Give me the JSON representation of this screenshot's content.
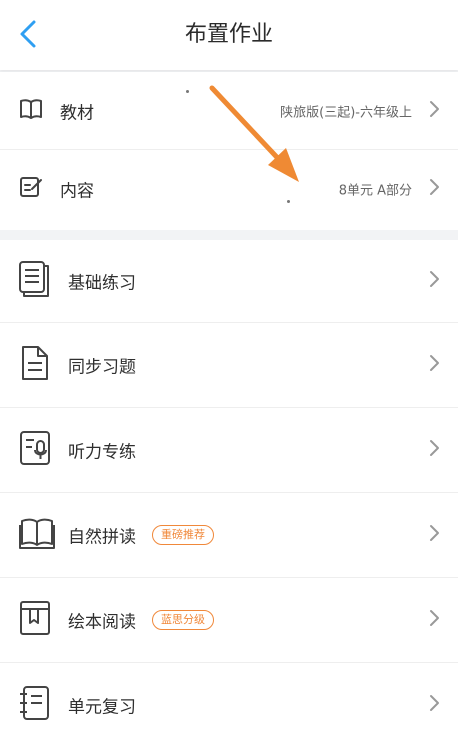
{
  "header": {
    "title": "布置作业"
  },
  "top_rows": [
    {
      "label": "教材",
      "value": "陕旅版(三起)-六年级上"
    },
    {
      "label": "内容",
      "value": "8单元 A部分"
    }
  ],
  "practice_rows": [
    {
      "label": "基础练习",
      "badge": ""
    },
    {
      "label": "同步习题",
      "badge": ""
    },
    {
      "label": "听力专练",
      "badge": ""
    },
    {
      "label": "自然拼读",
      "badge": "重磅推荐"
    },
    {
      "label": "绘本阅读",
      "badge": "蓝思分级"
    },
    {
      "label": "单元复习",
      "badge": ""
    }
  ],
  "colors": {
    "accent_blue": "#2f9ff2",
    "arrow_orange": "#ef8a34",
    "badge_orange": "#f0883a"
  }
}
